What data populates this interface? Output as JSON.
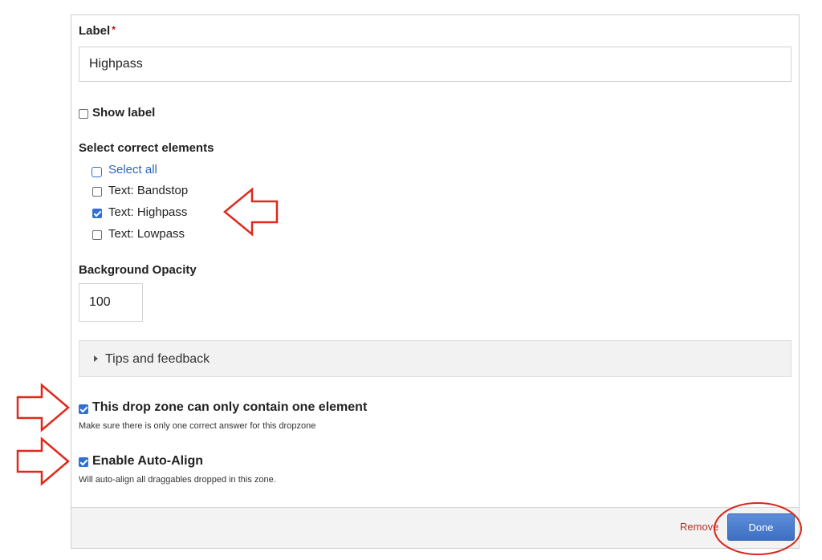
{
  "label_field": {
    "label": "Label",
    "required_mark": "*",
    "value": "Highpass"
  },
  "show_label": {
    "label": "Show label",
    "checked": false
  },
  "correct_elements": {
    "heading": "Select correct elements",
    "select_all": "Select all",
    "options": [
      {
        "label": "Text: Bandstop",
        "checked": false
      },
      {
        "label": "Text: Highpass",
        "checked": true
      },
      {
        "label": "Text: Lowpass",
        "checked": false
      }
    ]
  },
  "background_opacity": {
    "label": "Background Opacity",
    "value": "100"
  },
  "tips": {
    "label": "Tips and feedback"
  },
  "single_element": {
    "label": "This drop zone can only contain one element",
    "help": "Make sure there is only one correct answer for this dropzone",
    "checked": true
  },
  "auto_align": {
    "label": "Enable Auto-Align",
    "help": "Will auto-align all draggables dropped in this zone.",
    "checked": true
  },
  "footer": {
    "remove_label": "Remove",
    "done_label": "Done"
  },
  "colors": {
    "annotation": "#e0291c",
    "accent": "#2f6fd6",
    "remove": "#b0322a"
  }
}
